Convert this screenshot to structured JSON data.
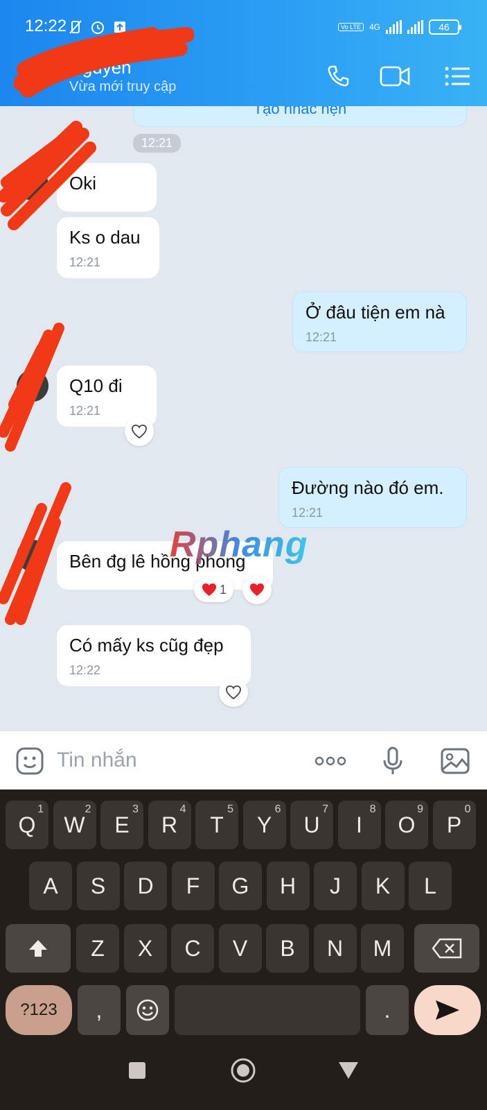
{
  "status_bar": {
    "time": "12:22",
    "network": "4G",
    "volte": "Vo LTE",
    "battery": "46"
  },
  "header": {
    "contact_name": "Nguyễn",
    "contact_status": "Vừa mới truy cập"
  },
  "chat": {
    "reminder_text": "Tạo nhắc hẹn",
    "time_divider": "12:21",
    "messages": [
      {
        "text": "Oki",
        "time": ""
      },
      {
        "text": "Ks o dau",
        "time": "12:21"
      },
      {
        "text": "Ở đâu tiện em nà",
        "time": "12:21"
      },
      {
        "text": "Q10 đi",
        "time": "12:21"
      },
      {
        "text": "Đường nào đó em.",
        "time": "12:21"
      },
      {
        "text": "Bên đg lê hồng phong",
        "time": "",
        "reaction_count": "1"
      },
      {
        "text": "Có mấy ks cũg đẹp",
        "time": "12:22"
      }
    ],
    "watermark": "Rphang"
  },
  "input": {
    "placeholder": "Tin nhắn"
  },
  "keyboard": {
    "row1": [
      {
        "k": "Q",
        "n": "1"
      },
      {
        "k": "W",
        "n": "2"
      },
      {
        "k": "E",
        "n": "3"
      },
      {
        "k": "R",
        "n": "4"
      },
      {
        "k": "T",
        "n": "5"
      },
      {
        "k": "Y",
        "n": "6"
      },
      {
        "k": "U",
        "n": "7"
      },
      {
        "k": "I",
        "n": "8"
      },
      {
        "k": "O",
        "n": "9"
      },
      {
        "k": "P",
        "n": "0"
      }
    ],
    "row2": [
      "A",
      "S",
      "D",
      "F",
      "G",
      "H",
      "J",
      "K",
      "L"
    ],
    "row3": [
      "Z",
      "X",
      "C",
      "V",
      "B",
      "N",
      "M"
    ],
    "symbols": "?123",
    "comma": ",",
    "period": "."
  },
  "colors": {
    "header": "#1c86ee",
    "incoming": "#ffffff",
    "outgoing": "#d4efff",
    "keyboard": "#241e1a"
  }
}
